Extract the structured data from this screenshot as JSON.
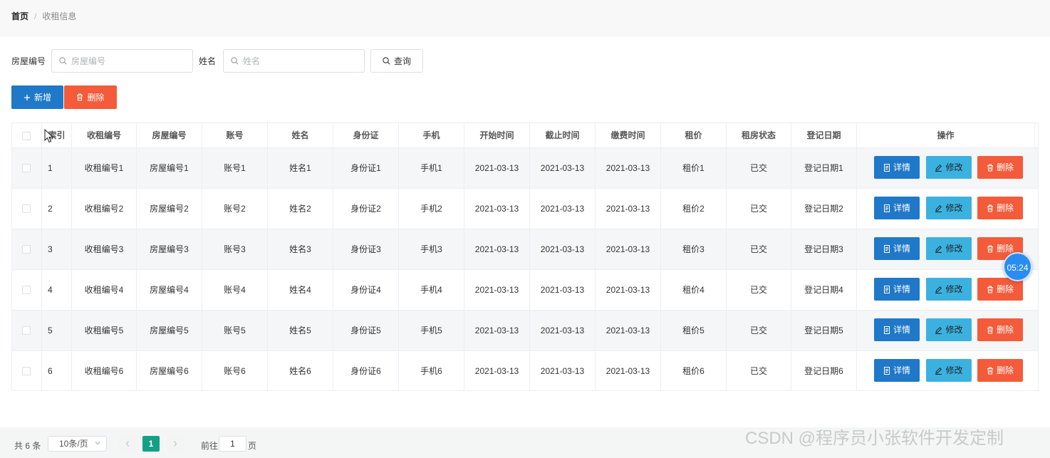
{
  "breadcrumb": {
    "home": "首页",
    "separator": "/",
    "current": "收租信息"
  },
  "search": {
    "house_label": "房屋编号",
    "house_placeholder": "房屋编号",
    "name_label": "姓名",
    "name_placeholder": "姓名",
    "query_label": "查询"
  },
  "actions": {
    "add_label": "新增",
    "delete_label": "删除"
  },
  "table": {
    "headers": [
      "索引",
      "收租编号",
      "房屋编号",
      "账号",
      "姓名",
      "身份证",
      "手机",
      "开始时间",
      "截止时间",
      "缴费时间",
      "租价",
      "租房状态",
      "登记日期",
      "操作"
    ],
    "rows": [
      [
        "1",
        "收租编号1",
        "房屋编号1",
        "账号1",
        "姓名1",
        "身份证1",
        "手机1",
        "2021-03-13",
        "2021-03-13",
        "2021-03-13",
        "租价1",
        "已交",
        "登记日期1"
      ],
      [
        "2",
        "收租编号2",
        "房屋编号2",
        "账号2",
        "姓名2",
        "身份证2",
        "手机2",
        "2021-03-13",
        "2021-03-13",
        "2021-03-13",
        "租价2",
        "已交",
        "登记日期2"
      ],
      [
        "3",
        "收租编号3",
        "房屋编号3",
        "账号3",
        "姓名3",
        "身份证3",
        "手机3",
        "2021-03-13",
        "2021-03-13",
        "2021-03-13",
        "租价3",
        "已交",
        "登记日期3"
      ],
      [
        "4",
        "收租编号4",
        "房屋编号4",
        "账号4",
        "姓名4",
        "身份证4",
        "手机4",
        "2021-03-13",
        "2021-03-13",
        "2021-03-13",
        "租价4",
        "已交",
        "登记日期4"
      ],
      [
        "5",
        "收租编号5",
        "房屋编号5",
        "账号5",
        "姓名5",
        "身份证5",
        "手机5",
        "2021-03-13",
        "2021-03-13",
        "2021-03-13",
        "租价5",
        "已交",
        "登记日期5"
      ],
      [
        "6",
        "收租编号6",
        "房屋编号6",
        "账号6",
        "姓名6",
        "身份证6",
        "手机6",
        "2021-03-13",
        "2021-03-13",
        "2021-03-13",
        "租价6",
        "已交",
        "登记日期6"
      ]
    ],
    "row_actions": {
      "detail": "详情",
      "edit": "修改",
      "delete": "删除"
    }
  },
  "pagination": {
    "total": "共 6 条",
    "page_size": "10条/页",
    "current_page": "1",
    "goto_prefix": "前往",
    "goto_value": "1",
    "goto_suffix": "页"
  },
  "timer": "05:24",
  "watermark": "CSDN @程序员小张软件开发定制",
  "colors": {
    "primary": "#1f78c8",
    "danger": "#f35b3a",
    "info": "#3bb1e0",
    "active_page": "#15a085"
  },
  "icons": [
    "search-icon",
    "plus-icon",
    "trash-icon",
    "document-icon",
    "pencil-icon",
    "chevron-left-icon",
    "chevron-right-icon",
    "chevron-down-icon",
    "cursor-icon"
  ]
}
